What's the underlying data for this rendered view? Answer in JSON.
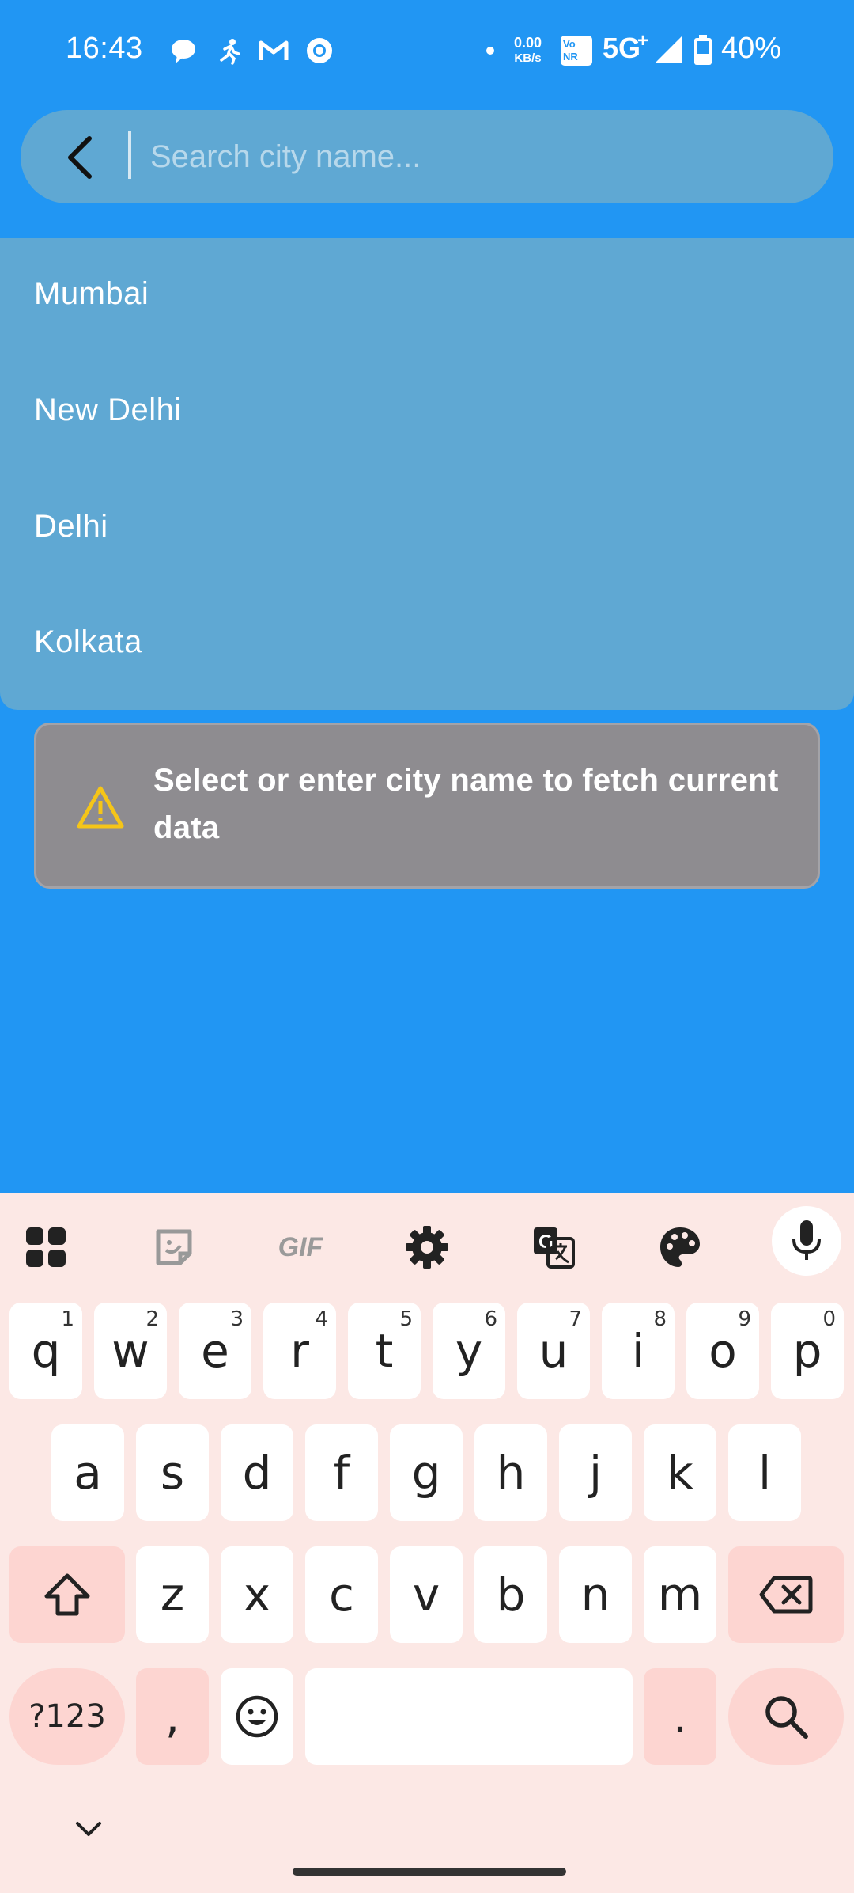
{
  "status_bar": {
    "time": "16:43",
    "net_speed_value": "0.00",
    "net_speed_unit": "KB/s",
    "network": "5G",
    "network_plus": "+",
    "battery": "40%",
    "volte_badge": "Vo NR"
  },
  "search": {
    "placeholder": "Search city name...",
    "value": ""
  },
  "suggestions": [
    "Mumbai",
    "New Delhi",
    "Delhi",
    "Kolkata"
  ],
  "warning": {
    "message": "Select or enter city name to fetch current data"
  },
  "keyboard": {
    "gif_label": "GIF",
    "row1": [
      {
        "key": "q",
        "hint": "1"
      },
      {
        "key": "w",
        "hint": "2"
      },
      {
        "key": "e",
        "hint": "3"
      },
      {
        "key": "r",
        "hint": "4"
      },
      {
        "key": "t",
        "hint": "5"
      },
      {
        "key": "y",
        "hint": "6"
      },
      {
        "key": "u",
        "hint": "7"
      },
      {
        "key": "i",
        "hint": "8"
      },
      {
        "key": "o",
        "hint": "9"
      },
      {
        "key": "p",
        "hint": "0"
      }
    ],
    "row2": [
      "a",
      "s",
      "d",
      "f",
      "g",
      "h",
      "j",
      "k",
      "l"
    ],
    "row3": [
      "z",
      "x",
      "c",
      "v",
      "b",
      "n",
      "m"
    ],
    "symbols_label": "?123",
    "comma_label": ",",
    "period_label": "."
  },
  "colors": {
    "app_background": "#2196f3",
    "search_bar": "#5fa8d3",
    "warning_card": "#8e8c90",
    "warning_icon": "#f5c518",
    "keyboard_background": "#fce8e5"
  }
}
